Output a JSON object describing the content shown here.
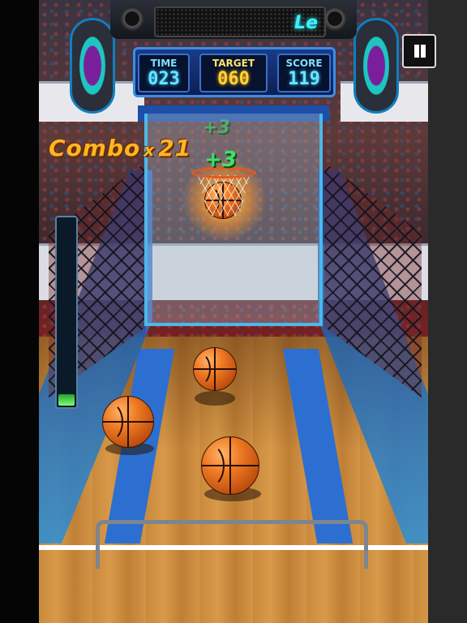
{
  "scoreboard": {
    "led_text": "Le",
    "time": {
      "label": "TIME",
      "value": "023"
    },
    "target": {
      "label": "TARGET",
      "value": "060"
    },
    "score": {
      "label": "SCORE",
      "value": "119"
    }
  },
  "combo": {
    "label": "Combo",
    "x": "x",
    "count": "21"
  },
  "popups": [
    "+3",
    "+3"
  ],
  "power_meter": {
    "level": 0.06
  },
  "controls": {
    "pause": "pause"
  },
  "colors": {
    "accent": "#3a8ee6",
    "score_text": "#66e6ff",
    "target_text": "#ffd23a",
    "combo": "#ffb524"
  }
}
